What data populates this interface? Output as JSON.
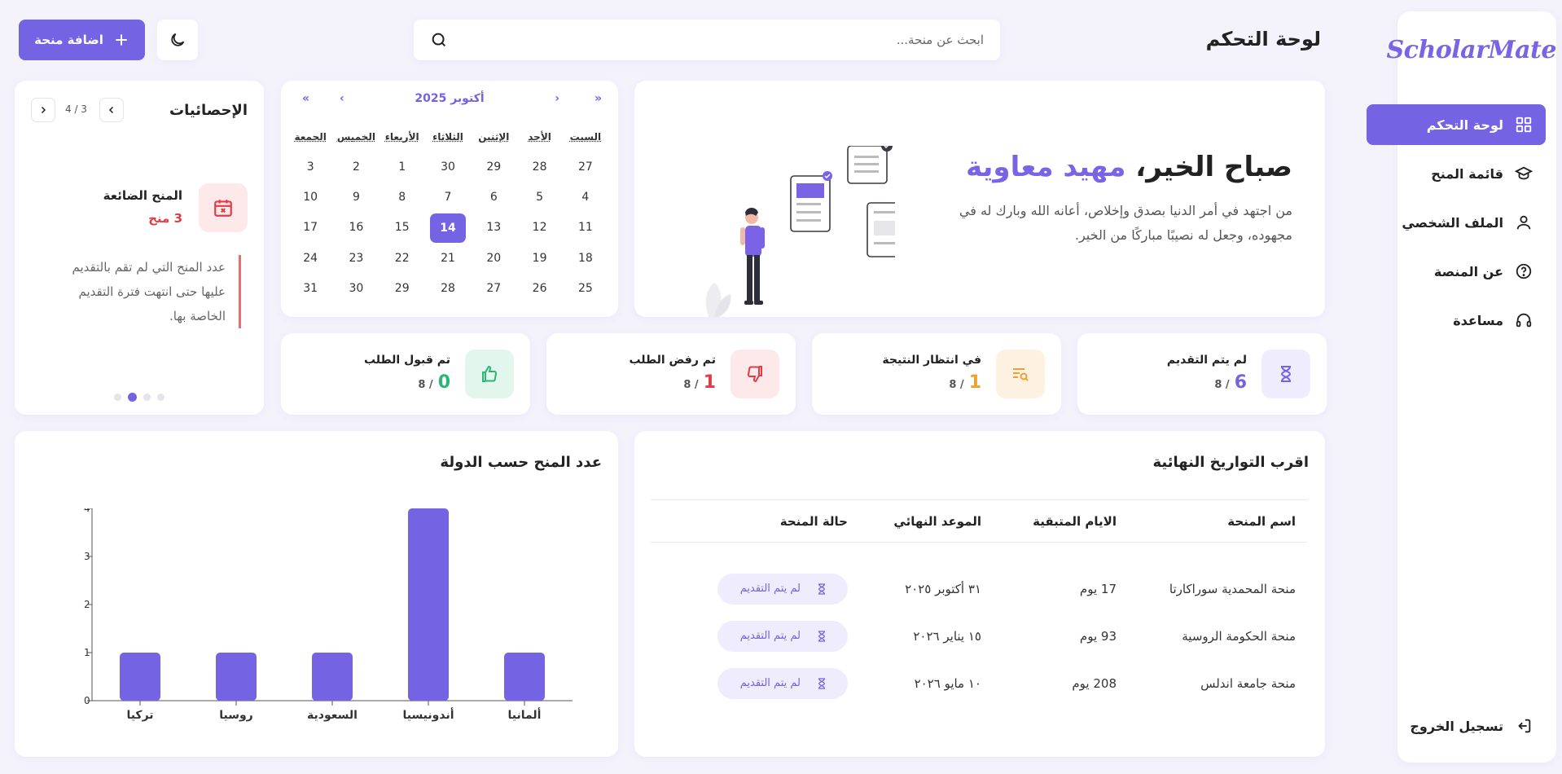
{
  "app": {
    "logo": "ScholarMate"
  },
  "sidebar": {
    "items": [
      {
        "label": "لوحة التحكم",
        "icon": "grid-icon",
        "active": true
      },
      {
        "label": "قائمة المنح",
        "icon": "graduation-cap-icon",
        "active": false
      },
      {
        "label": "الملف الشخصي",
        "icon": "user-icon",
        "active": false
      },
      {
        "label": "عن المنصة",
        "icon": "question-circle-icon",
        "active": false
      },
      {
        "label": "مساعدة",
        "icon": "headset-icon",
        "active": false
      }
    ],
    "logout": "تسجيل الخروج"
  },
  "header": {
    "title": "لوحة التحكم",
    "search_placeholder": "ابحث عن منحة...",
    "add_button": "اضافة منحة"
  },
  "welcome": {
    "greeting": "صباح الخير،",
    "name": "مهيد معاوية",
    "message": "من اجتهد في أمر الدنيا بصدق وإخلاص، أعانه الله وبارك له في مجهوده، وجعل له نصيبًا مباركًا من الخير."
  },
  "calendar": {
    "title": "أكتوبر 2025",
    "nav": {
      "prev_year": "«",
      "prev_month": "‹",
      "next_month": "›",
      "next_year": "»"
    },
    "weekdays": [
      "السبت",
      "الأحد",
      "الإثنين",
      "الثلاثاء",
      "الأربعاء",
      "الخميس",
      "الجمعة"
    ],
    "days": [
      27,
      28,
      29,
      30,
      1,
      2,
      3,
      4,
      5,
      6,
      7,
      8,
      9,
      10,
      11,
      12,
      13,
      14,
      15,
      16,
      17,
      18,
      19,
      20,
      21,
      22,
      23,
      24,
      25,
      26,
      27,
      28,
      29,
      30,
      31
    ],
    "today": 14
  },
  "statistics": {
    "title": "الإحصائيات",
    "pager": "4 / 3",
    "item_title": "المنح الضائعة",
    "item_count": "3 منح",
    "item_desc": "عدد المنح التي لم تقم بالتقديم عليها حتى انتهت فترة التقديم الخاصة بها.",
    "active_dot": 2,
    "dot_count": 4
  },
  "status_cards": [
    {
      "label": "لم يتم التقديم",
      "value": "6",
      "total": "/ 8",
      "icon": "hourglass-icon",
      "color": "#7464e3",
      "bg": "#efecfd"
    },
    {
      "label": "في انتظار النتيجة",
      "value": "1",
      "total": "/ 8",
      "icon": "search-list-icon",
      "color": "#f0a030",
      "bg": "#fdf1e2"
    },
    {
      "label": "تم رفض الطلب",
      "value": "1",
      "total": "/ 8",
      "icon": "thumbs-down-icon",
      "color": "#e23b45",
      "bg": "#fde9ea"
    },
    {
      "label": "تم قبول الطلب",
      "value": "0",
      "total": "/ 8",
      "icon": "thumbs-up-icon",
      "color": "#2bb673",
      "bg": "#e3f6ed"
    }
  ],
  "deadlines": {
    "title": "اقرب التواريخ النهائية",
    "columns": [
      "اسم المنحة",
      "الايام المتبقية",
      "الموعد النهائي",
      "حالة المنحة"
    ],
    "rows": [
      {
        "name": "منحة المحمدية سوراكارتا",
        "days": "17 يوم",
        "date": "٣١ أكتوبر ٢٠٢٥",
        "status": "لم يتم التقديم"
      },
      {
        "name": "منحة الحكومة الروسية",
        "days": "93 يوم",
        "date": "١٥ يناير ٢٠٢٦",
        "status": "لم يتم التقديم"
      },
      {
        "name": "منحة جامعة اندلس",
        "days": "208 يوم",
        "date": "١٠ مايو ٢٠٢٦",
        "status": "لم يتم التقديم"
      }
    ]
  },
  "chart": {
    "title": "عدد المنح حسب الدولة"
  },
  "chart_data": {
    "type": "bar",
    "categories": [
      "تركيا",
      "روسيا",
      "السعودية",
      "أندونيسيا",
      "ألمانيا"
    ],
    "values": [
      1,
      1,
      1,
      4,
      1
    ],
    "ylim": [
      0,
      4
    ],
    "yticks": [
      0,
      1,
      2,
      3,
      4
    ],
    "bar_color": "#7464e3",
    "xlabel": "",
    "ylabel": ""
  }
}
